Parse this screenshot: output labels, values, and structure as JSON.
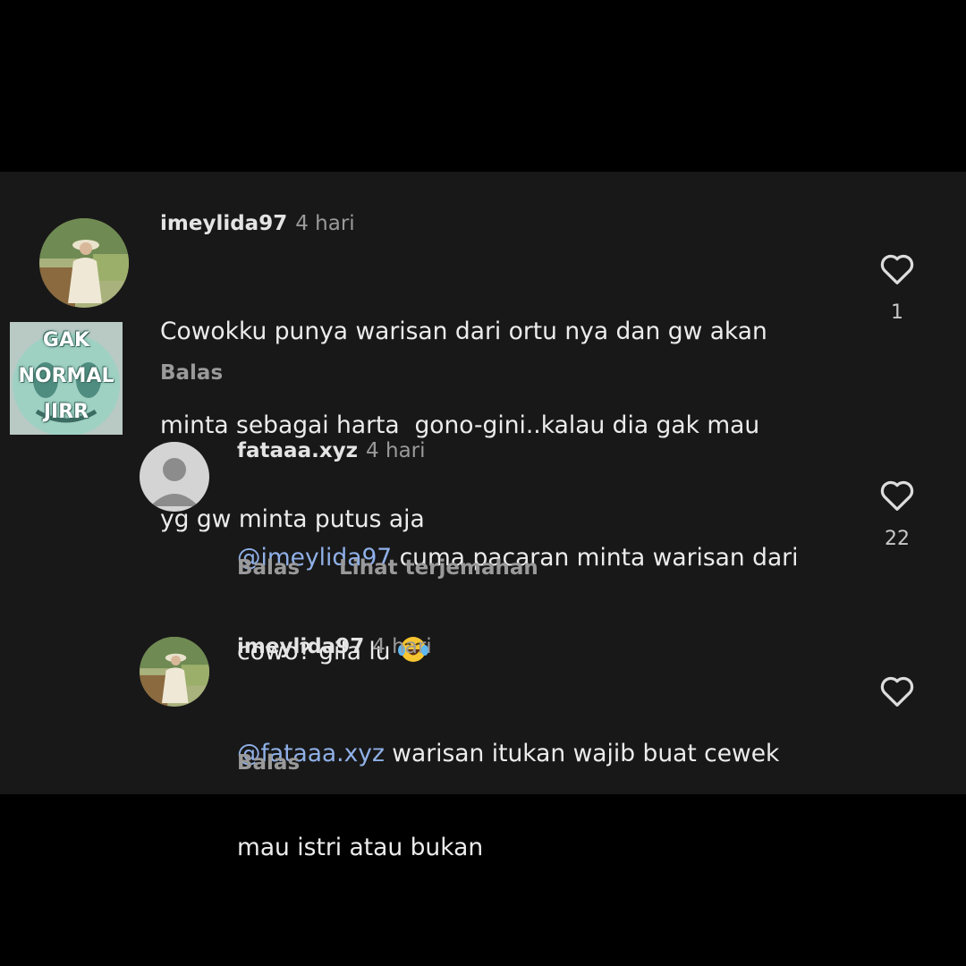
{
  "comments": [
    {
      "username": "imeylida97",
      "time": "4 hari",
      "text_lines": [
        "Cowokku punya warisan dari ortu nya dan gw akan",
        "minta sebagai harta  gono-gini..kalau dia gak mau",
        "yg gw minta putus aja"
      ],
      "reply_label": "Balas",
      "like_count": "1"
    },
    {
      "username": "fataaa.xyz",
      "time": "4 hari",
      "mention": "@imeylida97",
      "text_line1": " cuma pacaran minta warisan dari",
      "text_line2": "cowo? gila lu ",
      "emoji": "laughing-face-emoji",
      "reply_label": "Balas",
      "translate_label": "Lihat terjemahan",
      "like_count": "22"
    },
    {
      "username": "imeylida97",
      "time": "4 hari",
      "mention": "@fataaa.xyz",
      "text_line1": " warisan itukan wajib buat cewek",
      "text_line2": "mau istri atau bukan",
      "reply_label": "Balas"
    }
  ],
  "sticker": {
    "lines": [
      "GAK",
      "NORMAL",
      "JIRR"
    ]
  },
  "icons": {
    "like": "heart-outline-icon",
    "default_avatar": "user-silhouette-icon"
  },
  "colors": {
    "background": "#181818",
    "mention": "#8fb0e8",
    "muted": "#9a9a9a"
  }
}
